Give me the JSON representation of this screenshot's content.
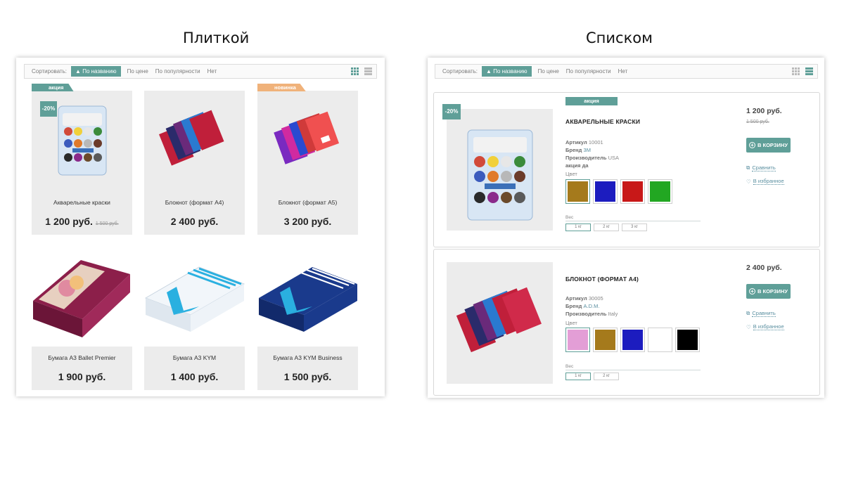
{
  "headings": {
    "tiles": "Плиткой",
    "list": "Списком"
  },
  "colors": {
    "accent": "#5f9f98",
    "new_badge": "#f0b27a",
    "link": "#5a8fa0"
  },
  "sort": {
    "label": "Сортировать:",
    "options": [
      "По названию",
      "По цене",
      "По популярности",
      "Нет"
    ],
    "active_arrow": "▲"
  },
  "tiles": [
    {
      "name": "Акварельные краски",
      "price": "1 200 руб.",
      "old_price": "1 500 руб.",
      "badge": "акция",
      "discount": "-20%",
      "image": "watercolor-paints"
    },
    {
      "name": "Блокнот (формат А4)",
      "price": "2 400 руб.",
      "image": "notebooks-a4"
    },
    {
      "name": "Блокнот (формат А5)",
      "price": "3 200 руб.",
      "badge": "новинка",
      "image": "notebooks-a5"
    },
    {
      "name": "Бумага А3 Ballet Premier",
      "price": "1 900 руб.",
      "image": "paper-ballet"
    },
    {
      "name": "Бумага А3 KYM",
      "price": "1 400 руб.",
      "image": "paper-kym"
    },
    {
      "name": "Бумага А3 KYM Business",
      "price": "1 500 руб.",
      "image": "paper-kym-business"
    }
  ],
  "list": [
    {
      "badge": "акция",
      "discount": "-20%",
      "title": "АКВАРЕЛЬНЫЕ КРАСКИ",
      "article_label": "Артикул",
      "article": "10001",
      "brand_label": "Бренд",
      "brand": "3M",
      "maker_label": "Производитель",
      "maker": "USA",
      "promo_label": "акция",
      "promo": "да",
      "color_label": "Цвет",
      "colors": [
        "#a57a1c",
        "#1c1cbf",
        "#c81818",
        "#22a722"
      ],
      "weight_label": "Вес",
      "weights": [
        "1 кг",
        "2 кг",
        "3 кг"
      ],
      "price": "1 200 руб.",
      "old_price": "1 500 руб.",
      "cart": "В КОРЗИНУ",
      "compare": "Сравнить",
      "favorite": "В избранное"
    },
    {
      "title": "БЛОКНОТ (ФОРМАТ А4)",
      "article_label": "Артикул",
      "article": "30005",
      "brand_label": "Бренд",
      "brand": "A.D.M.",
      "maker_label": "Производитель",
      "maker": "Italy",
      "color_label": "Цвет",
      "colors": [
        "#e39ed6",
        "#a57a1c",
        "#1c1cbf",
        "#ffffff",
        "#000000"
      ],
      "weight_label": "Вес",
      "weights": [
        "1 кг",
        "2 кг"
      ],
      "price": "2 400 руб.",
      "cart": "В КОРЗИНУ",
      "compare": "Сравнить",
      "favorite": "В избранное"
    }
  ]
}
